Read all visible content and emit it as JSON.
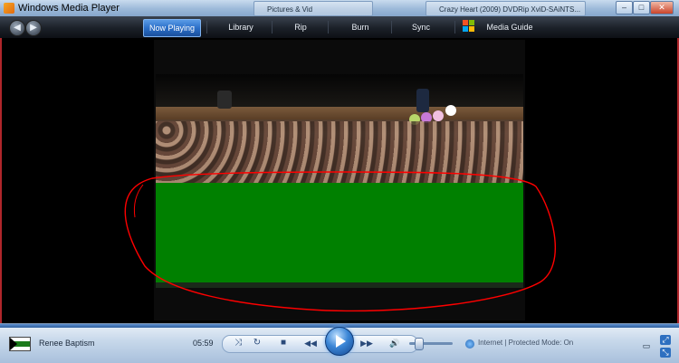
{
  "window": {
    "title": "Windows Media Player",
    "buttons": {
      "minimize": "–",
      "maximize": "□",
      "close": "✕"
    }
  },
  "background_windows": [
    {
      "text": "Pictures & Vid"
    },
    {
      "text": "Crazy Heart (2009) DVDRip XviD-SAiNTS..."
    }
  ],
  "nav": {
    "back": "◀",
    "forward": "▶",
    "tabs": [
      {
        "label": "Now Playing",
        "active": true
      },
      {
        "label": "Library",
        "active": false
      },
      {
        "label": "Rip",
        "active": false
      },
      {
        "label": "Burn",
        "active": false
      },
      {
        "label": "Sync",
        "active": false
      },
      {
        "label": "Media Guide",
        "active": false
      }
    ]
  },
  "player": {
    "track_title": "Renee Baptism",
    "elapsed_time": "05:59",
    "controls": {
      "shuffle": "⤨",
      "repeat": "↻",
      "stop": "■",
      "previous": "◀◀",
      "next": "▶▶",
      "mute": "🔊",
      "play_icon": "play-icon"
    },
    "volume_level": 0.2
  },
  "status": {
    "fragment": "Internet | Protected Mode: On"
  },
  "colors": {
    "annotation_red": "#ff0000",
    "video_green": "#008000",
    "active_tab": "#2b6fc8"
  }
}
